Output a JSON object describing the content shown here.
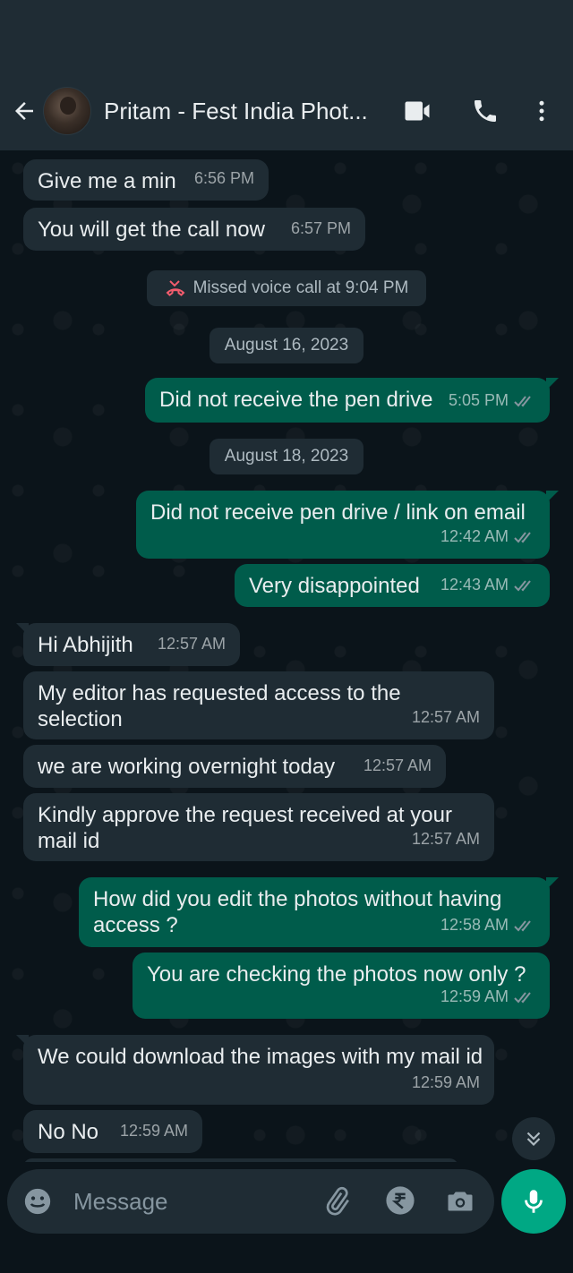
{
  "header": {
    "contact_name": "Pritam - Fest India Phot..."
  },
  "icons": {
    "back": "back-arrow-icon",
    "video": "video-call-icon",
    "voice": "voice-call-icon",
    "menu": "more-vert-icon"
  },
  "colors": {
    "header_bg": "#1f2c34",
    "incoming_bubble": "#1f2c34",
    "outgoing_bubble": "#005c4b",
    "accent": "#00a884",
    "missed_call": "#f15c6d",
    "read_ticks": "#8696a0"
  },
  "messages": [
    {
      "type": "in",
      "text": "Give me a min",
      "time": "6:56 PM"
    },
    {
      "type": "in",
      "text": "You will get the call now",
      "time": "6:57 PM"
    },
    {
      "type": "system",
      "text": "Missed voice call at 9:04 PM"
    },
    {
      "type": "date",
      "text": "August 16, 2023"
    },
    {
      "type": "out",
      "text": "Did not receive the pen drive",
      "time": "5:05 PM"
    },
    {
      "type": "date",
      "text": "August 18, 2023"
    },
    {
      "type": "out",
      "text": "Did not receive pen drive / link on email",
      "time": "12:42 AM"
    },
    {
      "type": "out",
      "text": "Very disappointed",
      "time": "12:43 AM"
    },
    {
      "type": "in",
      "text": "Hi Abhijith",
      "time": "12:57 AM"
    },
    {
      "type": "in",
      "text": "My editor has requested access to the selection",
      "time": "12:57 AM"
    },
    {
      "type": "in",
      "text": "we are working overnight today",
      "time": "12:57 AM"
    },
    {
      "type": "in",
      "text": "Kindly approve the request received at your mail id",
      "time": "12:57 AM"
    },
    {
      "type": "out",
      "text": "How did you edit the photos without having access ?",
      "time": "12:58 AM"
    },
    {
      "type": "out",
      "text": "You are checking the photos now only ?",
      "time": "12:59 AM"
    },
    {
      "type": "in",
      "text": "We could download the images with my mail id",
      "time": "12:59 AM"
    },
    {
      "type": "in",
      "text": "No No",
      "time": "12:59 AM"
    }
  ],
  "composer": {
    "placeholder": "Message"
  }
}
